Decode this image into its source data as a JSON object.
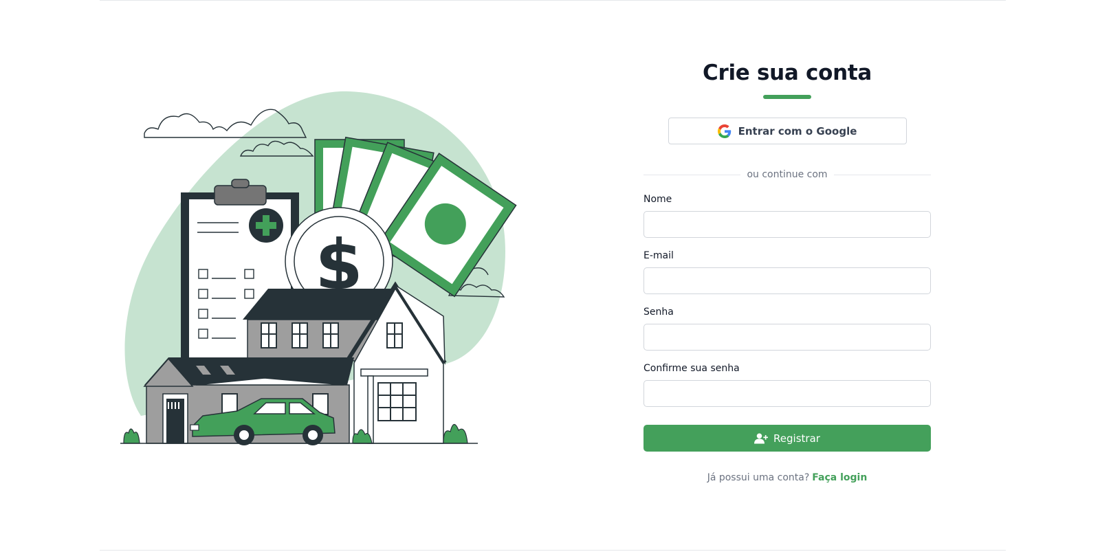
{
  "form": {
    "title": "Crie sua conta",
    "google_button_label": "Entrar com o Google",
    "divider_text": "ou continue com",
    "fields": [
      {
        "label": "Nome",
        "value": "",
        "placeholder": ""
      },
      {
        "label": "E-mail",
        "value": "",
        "placeholder": ""
      },
      {
        "label": "Senha",
        "value": "",
        "placeholder": ""
      },
      {
        "label": "Confirme sua senha",
        "value": "",
        "placeholder": ""
      }
    ],
    "register_button_label": "Registrar",
    "login_prompt": "Já possui uma conta?",
    "login_link": "Faça login"
  },
  "icons": {
    "google": "google-g-logo",
    "register": "user-plus-icon"
  },
  "colors": {
    "accent": "#44a05b",
    "blob": "#c6e3d0",
    "dark": "#263238",
    "text": "#111827",
    "muted": "#6b7280"
  }
}
